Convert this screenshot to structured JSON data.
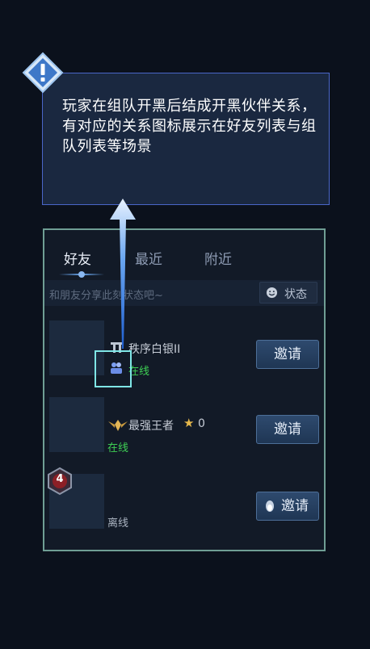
{
  "tooltip": {
    "text": "玩家在组队开黑后结成开黑伙伴关系，有对应的关系图标展示在好友列表与组队列表等场景"
  },
  "tabs": [
    {
      "label": "好友",
      "active": true
    },
    {
      "label": "最近",
      "active": false
    },
    {
      "label": "附近",
      "active": false
    }
  ],
  "status": {
    "placeholder": "和朋友分享此刻状态吧~",
    "button_label": "状态"
  },
  "friends": [
    {
      "rank": "秩序白银II",
      "status": "在线",
      "invite_label": "邀请",
      "relation_icon": "duo-partner-icon"
    },
    {
      "rank": "最强王者",
      "stars": "0",
      "status": "在线",
      "invite_label": "邀请",
      "rank_icon": "king-wings-icon"
    },
    {
      "rank": "",
      "status": "离线",
      "invite_label": "邀请",
      "badge_number": "4",
      "invite_icon": "qq-penguin-icon"
    }
  ],
  "colors": {
    "online": "#3ecf54",
    "tooltip_border": "#4a66c8",
    "panel_border": "#6f9e94",
    "highlight": "#7fe6e6"
  }
}
